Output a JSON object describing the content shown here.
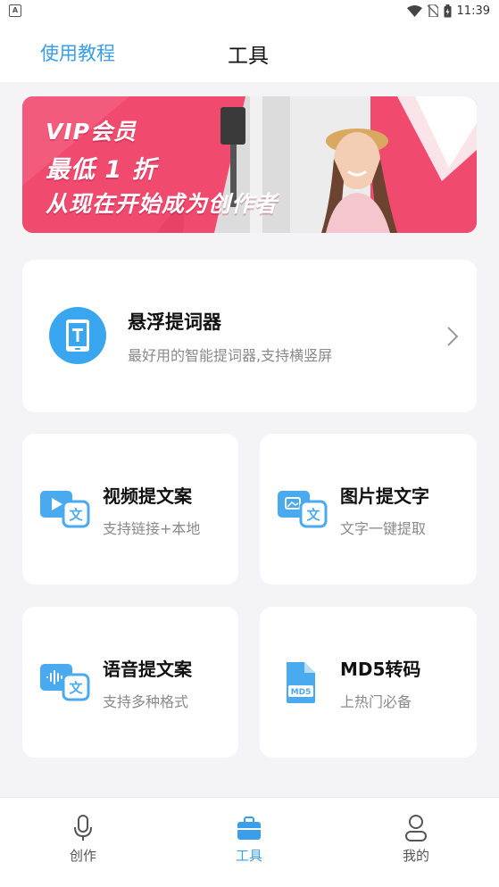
{
  "status_bar": {
    "time": "11:39"
  },
  "header": {
    "tutorial_label": "使用教程",
    "title": "工具"
  },
  "banner": {
    "line1": "VIP会员",
    "line2": "最低 1 折",
    "line3": "从现在开始成为创作者"
  },
  "feature": {
    "title": "悬浮提词器",
    "subtitle": "最好用的智能提词器,支持横竖屏"
  },
  "tools": [
    {
      "title": "视频提文案",
      "subtitle": "支持链接+本地",
      "icon": "video-to-text-icon"
    },
    {
      "title": "图片提文字",
      "subtitle": "文字一键提取",
      "icon": "image-to-text-icon"
    },
    {
      "title": "语音提文案",
      "subtitle": "支持多种格式",
      "icon": "audio-to-text-icon"
    },
    {
      "title": "MD5转码",
      "subtitle": "上热门必备",
      "icon": "md5-file-icon"
    }
  ],
  "tabbar": {
    "items": [
      {
        "label": "创作",
        "icon": "microphone-icon"
      },
      {
        "label": "工具",
        "icon": "toolbox-icon",
        "active": true
      },
      {
        "label": "我的",
        "icon": "user-icon"
      }
    ]
  },
  "colors": {
    "accent": "#3a9ee8",
    "banner": "#f04a6e"
  }
}
